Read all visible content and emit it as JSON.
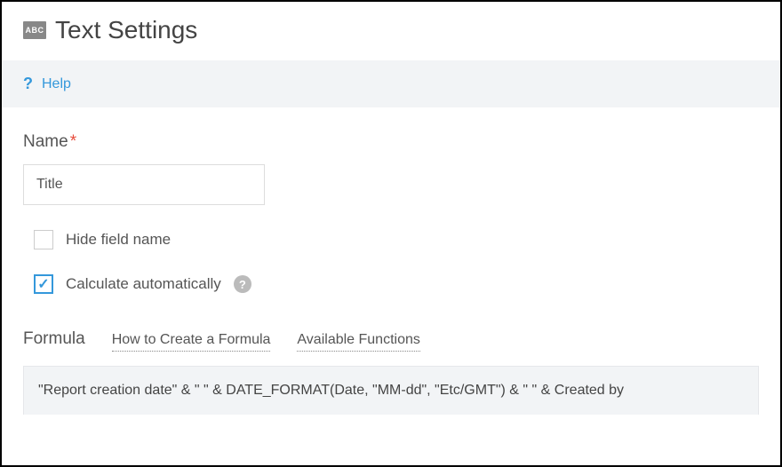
{
  "header": {
    "icon_label": "ABC",
    "title": "Text Settings"
  },
  "help": {
    "icon": "?",
    "label": "Help"
  },
  "name_field": {
    "label": "Name",
    "required": "*",
    "value": "Title"
  },
  "hide_field": {
    "label": "Hide field name",
    "checked": false
  },
  "calc_auto": {
    "label": "Calculate automatically",
    "checked": true,
    "info": "?"
  },
  "formula": {
    "label": "Formula",
    "link_create": "How to Create a Formula",
    "link_functions": "Available Functions",
    "content": "\"Report creation date\" & \" \" & DATE_FORMAT(Date, \"MM-dd\", \"Etc/GMT\") & \" \" & Created by"
  }
}
